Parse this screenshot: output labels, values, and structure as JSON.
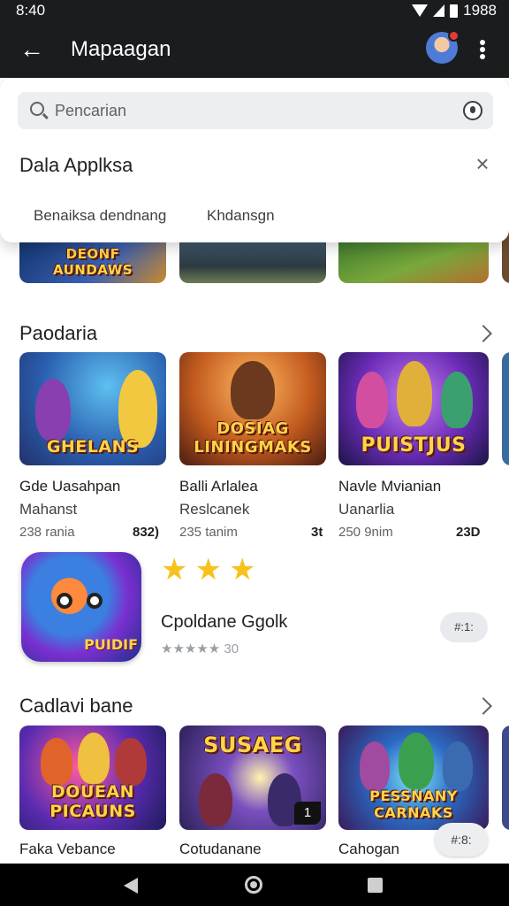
{
  "status_bar": {
    "time": "8:40",
    "battery": "1988"
  },
  "app_bar": {
    "title": "Mapaagan",
    "back_icon": "arrow-back-icon",
    "avatar_icon": "avatar-icon",
    "more_icon": "more-vert-icon"
  },
  "search_panel": {
    "placeholder": "Pencarian",
    "title": "Dala Applksa",
    "tabs": [
      "Benaiksa dendnang",
      "Khdansgn"
    ]
  },
  "sections": [
    {
      "title": "Paodaria",
      "games": [
        {
          "art_text": "GHELANS",
          "name": "Gde Uasahpan",
          "sub": "Mahanst",
          "meta": "238 rania",
          "badge": "832)"
        },
        {
          "art_text": "DOSIAG LININGMAKS",
          "name": "Balli Arlalea",
          "sub": "Reslcanek",
          "meta": "235 tanim",
          "badge": "3t"
        },
        {
          "art_text": "PUISTJUS",
          "name": "Navle Mvianian",
          "sub": "Uanarlia",
          "meta": "250 9nim",
          "badge": "23D"
        }
      ]
    },
    {
      "title": "Cadlavi bane",
      "games": [
        {
          "art_text": "DOUEAN PICAUNS",
          "name": "Faka Vebance"
        },
        {
          "art_text": "SUSAEG",
          "name": "Cotudanane"
        },
        {
          "art_text": "PESSNANY CARNAKS",
          "name": "Cahogan"
        }
      ]
    }
  ],
  "top_row_art": [
    "DEONF AUNDAWS"
  ],
  "featured": {
    "art_text": "PUIDIF",
    "stars": 3,
    "name": "Cpoldane Ggolk",
    "rating_text": "★★★★★ 30",
    "button": "#:1:"
  },
  "corner_tag": "1",
  "float_chip": "#:8:",
  "colors": {
    "app_bar": "#1b1c1e",
    "star": "#f7c21d",
    "background": "#ffffff"
  }
}
